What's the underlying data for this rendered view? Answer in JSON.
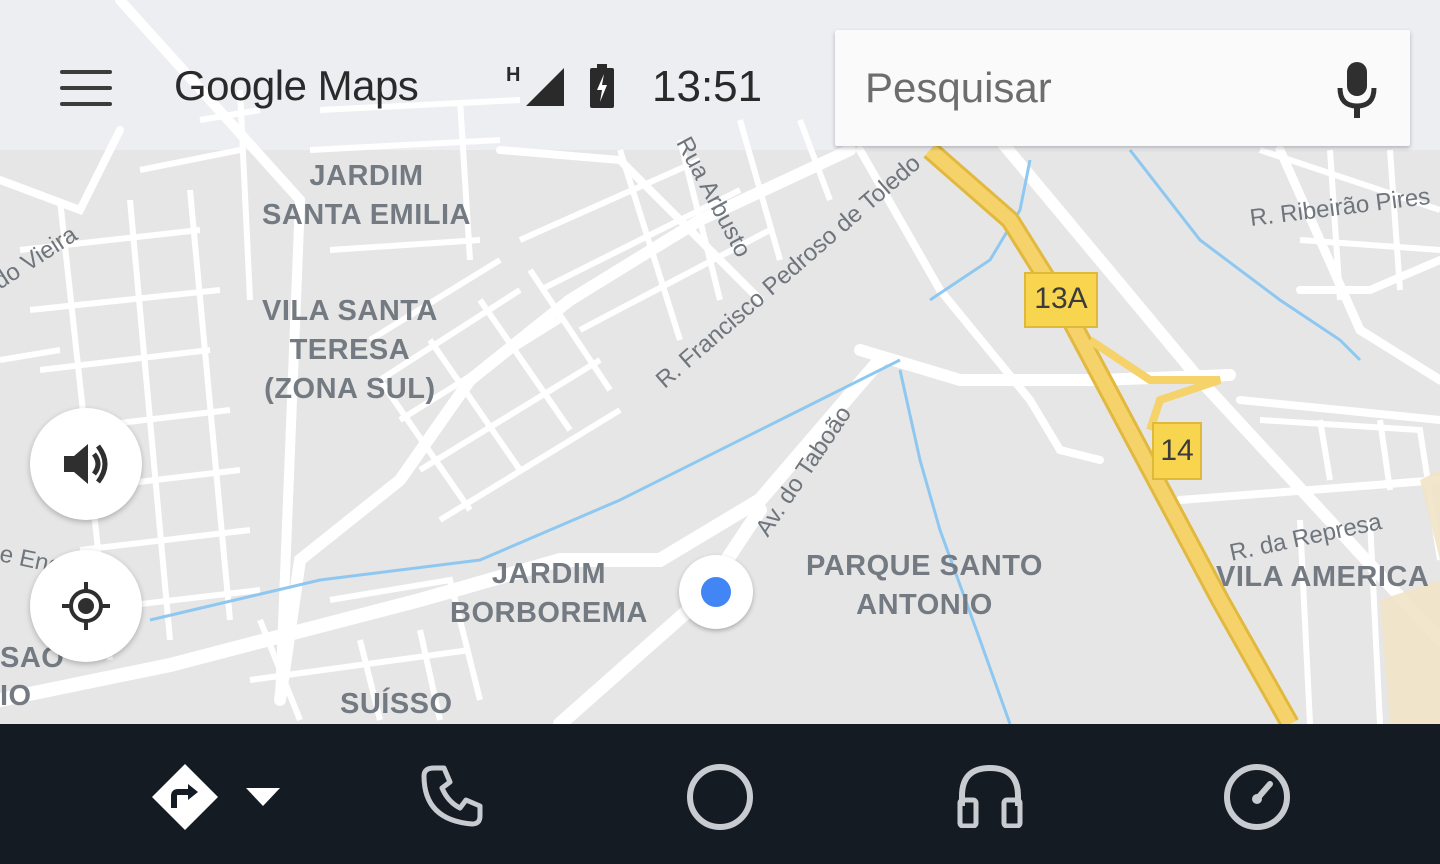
{
  "header": {
    "app_title": "Google Maps",
    "network_type": "H",
    "clock": "13:51",
    "menu_icon": "hamburger-menu-icon"
  },
  "search": {
    "placeholder": "Pesquisar",
    "mic_icon": "microphone-icon"
  },
  "map": {
    "area_labels": {
      "jardim_santa_emilia": "JARDIM\nSANTA EMILIA",
      "vila_santa_teresa": "VILA SANTA\nTERESA\n(ZONA SUL)",
      "jardim_borborema": "JARDIM\nBORBOREMA",
      "parque_santo_antonio": "PARQUE SANTO\nANTONIO",
      "vila_america": "VILA AMERICA",
      "suisso": "SUÍSSO",
      "sao_partial": "SAO",
      "io_partial": "IO"
    },
    "street_labels": {
      "do_vieira": "do Vieira",
      "rua_arbusto": "Rua Arbusto",
      "francisco_pedroso": "R. Francisco Pedroso de Toledo",
      "ribeirao_pires": "R. Ribeirão Pires",
      "av_taboao": "Av. do Taboão",
      "da_represa": "R. da Represa",
      "e_eng": "e Eng"
    },
    "highway_shields": {
      "exit_13a": "13A",
      "exit_14": "14"
    },
    "colors": {
      "background": "#e6e6e6",
      "road": "#ffffff",
      "highway": "#f6d36a",
      "water": "#8ec8f0",
      "location_dot": "#4285f4"
    }
  },
  "controls": {
    "volume_icon": "volume-icon",
    "recenter_icon": "my-location-icon"
  },
  "bottom_nav": {
    "background": "#141b22",
    "items": [
      "navigation-icon",
      "phone-icon",
      "home-circle-icon",
      "headphones-icon",
      "dashboard-gauge-icon"
    ]
  }
}
